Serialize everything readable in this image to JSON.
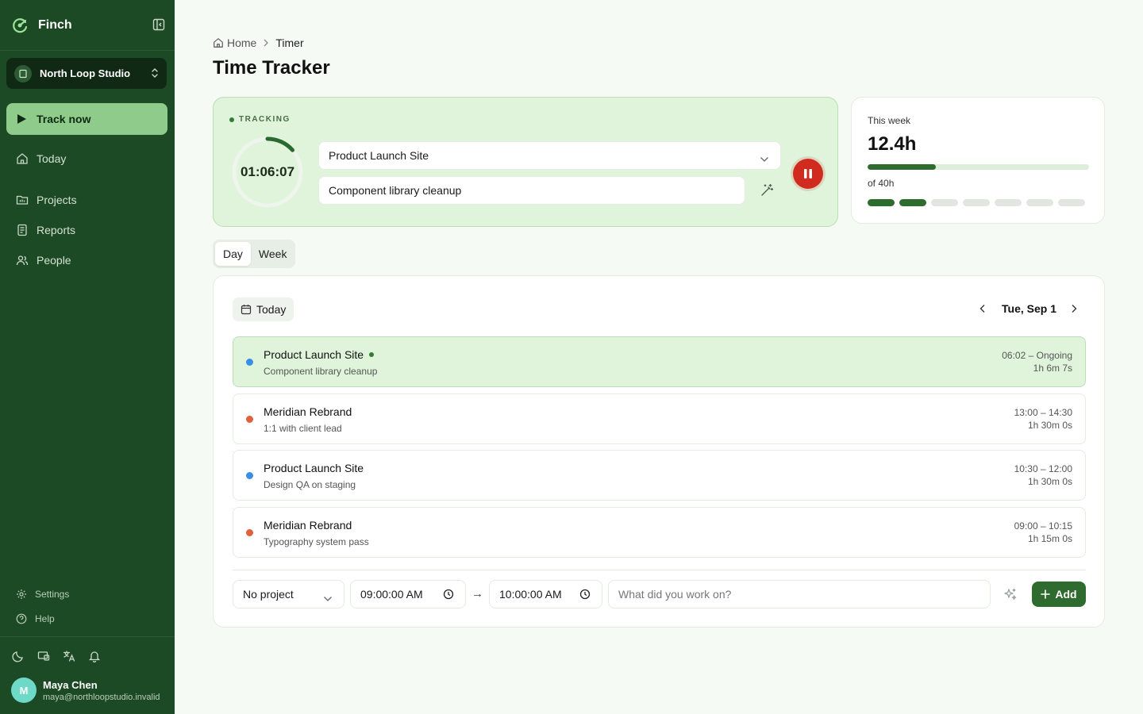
{
  "app": {
    "name": "Finch"
  },
  "workspace": {
    "name": "North Loop Studio"
  },
  "sidebar": {
    "track_now": "Track now",
    "nav": [
      {
        "label": "Today",
        "icon": "home-icon"
      },
      {
        "label": "Projects",
        "icon": "folder-icon"
      },
      {
        "label": "Reports",
        "icon": "document-icon"
      },
      {
        "label": "People",
        "icon": "users-icon"
      }
    ],
    "footer_nav": [
      {
        "label": "Settings",
        "icon": "gear-icon"
      },
      {
        "label": "Help",
        "icon": "help-icon"
      }
    ],
    "tools": [
      "moon-icon",
      "display-icon",
      "translate-icon",
      "bell-icon"
    ]
  },
  "user": {
    "initial": "M",
    "name": "Maya Chen",
    "email": "maya@northloopstudio.invalid"
  },
  "breadcrumb": {
    "home": "Home",
    "current": "Timer"
  },
  "page": {
    "title": "Time Tracker"
  },
  "tracker": {
    "status": "TRACKING",
    "elapsed": "01:06:07",
    "project": "Product Launch Site",
    "description": "Component library cleanup",
    "colors": {
      "accent": "#2f7d33",
      "stop": "#d12a1f"
    }
  },
  "week": {
    "label": "This week",
    "value": "12.4h",
    "goal": "of 40h",
    "progress": 0.31,
    "days_filled": 2,
    "days_total": 7
  },
  "view_toggle": {
    "day": "Day",
    "week": "Week",
    "selected": "Day"
  },
  "entries": {
    "today_label": "Today",
    "date": "Tue, Sep 1",
    "rows": [
      {
        "project": "Product Launch Site",
        "description": "Component library cleanup",
        "time": "06:02 – Ongoing",
        "duration": "1h 6m 7s",
        "color": "#3b8ee6",
        "active": true
      },
      {
        "project": "Meridian Rebrand",
        "description": "1:1 with client lead",
        "time": "13:00 – 14:30",
        "duration": "1h 30m 0s",
        "color": "#e0613b",
        "active": false
      },
      {
        "project": "Product Launch Site",
        "description": "Design QA on staging",
        "time": "10:30 – 12:00",
        "duration": "1h 30m 0s",
        "color": "#3b8ee6",
        "active": false
      },
      {
        "project": "Meridian Rebrand",
        "description": "Typography system pass",
        "time": "09:00 – 10:15",
        "duration": "1h 15m 0s",
        "color": "#e0613b",
        "active": false
      }
    ]
  },
  "manual_entry": {
    "project": "No project",
    "start": "09:00:00 AM",
    "arrow": "→",
    "end": "10:00:00 AM",
    "placeholder": "What did you work on?",
    "add_label": "Add"
  }
}
